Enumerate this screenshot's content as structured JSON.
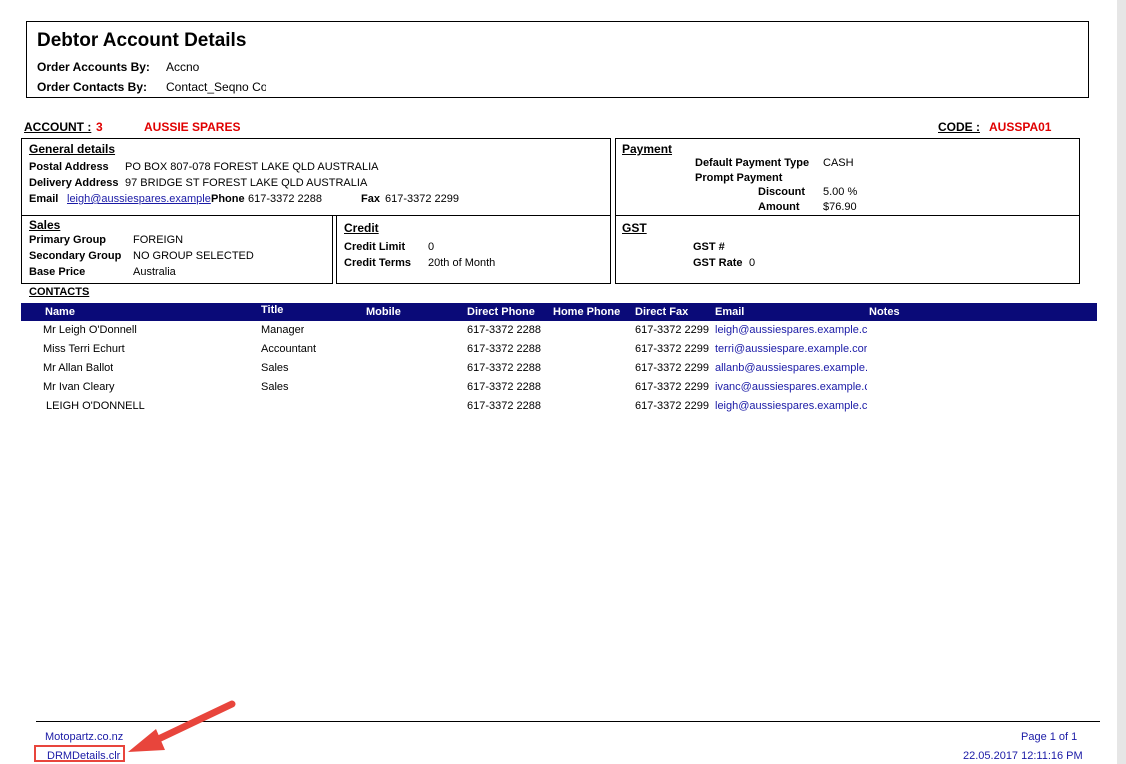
{
  "report": {
    "title": "Debtor Account Details",
    "order_accounts_label": "Order Accounts By:",
    "order_accounts_value": "Accno",
    "order_contacts_label": "Order Contacts By:",
    "order_contacts_value": "Contact_Seqno Co"
  },
  "account": {
    "account_label": "ACCOUNT :",
    "account_number": "3",
    "account_name": "AUSSIE SPARES",
    "code_label": "CODE :",
    "code_value": "AUSSPA01"
  },
  "general": {
    "heading": "General details",
    "postal_label": "Postal Address",
    "postal_value": "PO BOX 807-078 FOREST LAKE QLD AUSTRALIA",
    "delivery_label": "Delivery Address",
    "delivery_value": "97 BRIDGE ST FOREST LAKE QLD AUSTRALIA",
    "email_label": "Email",
    "email_value": "leigh@aussiespares.example",
    "phone_label": "Phone",
    "phone_value": "617-3372 2288",
    "fax_label": "Fax",
    "fax_value": "617-3372 2299"
  },
  "payment": {
    "heading": "Payment",
    "type_label": "Default Payment Type",
    "type_value": "CASH",
    "prompt_label": "Prompt Payment",
    "discount_label": "Discount",
    "discount_value": "5.00 %",
    "amount_label": "Amount",
    "amount_value": "$76.90"
  },
  "sales": {
    "heading": "Sales",
    "primary_label": "Primary Group",
    "primary_value": "FOREIGN",
    "secondary_label": "Secondary Group",
    "secondary_value": "NO GROUP SELECTED",
    "base_label": "Base Price",
    "base_value": "Australia"
  },
  "credit": {
    "heading": "Credit",
    "limit_label": "Credit Limit",
    "limit_value": "0",
    "terms_label": "Credit Terms",
    "terms_value": "20th of Month"
  },
  "gst": {
    "heading": "GST",
    "gst_no_label": "GST #",
    "rate_label": "GST Rate",
    "rate_value": "0"
  },
  "contacts": {
    "heading": "CONTACTS",
    "columns": [
      "Name",
      "Title",
      "Mobile",
      "Direct Phone",
      "Home Phone",
      "Direct Fax",
      "Email",
      "Notes"
    ],
    "rows": [
      {
        "name": "Mr Leigh O'Donnell",
        "title": "Manager",
        "mobile": "",
        "direct_phone": "617-3372 2288",
        "home_phone": "",
        "direct_fax": "617-3372 2299",
        "email": "leigh@aussiespares.example.c",
        "notes": ""
      },
      {
        "name": "Miss Terri Echurt",
        "title": "Accountant",
        "mobile": "",
        "direct_phone": "617-3372 2288",
        "home_phone": "",
        "direct_fax": "617-3372 2299",
        "email": "terri@aussiespare.example.cor",
        "notes": ""
      },
      {
        "name": "Mr Allan Ballot",
        "title": "Sales",
        "mobile": "",
        "direct_phone": "617-3372 2288",
        "home_phone": "",
        "direct_fax": "617-3372 2299",
        "email": "allanb@aussiespares.example.",
        "notes": ""
      },
      {
        "name": "Mr Ivan Cleary",
        "title": "Sales",
        "mobile": "",
        "direct_phone": "617-3372 2288",
        "home_phone": "",
        "direct_fax": "617-3372 2299",
        "email": "ivanc@aussiespares.example.c",
        "notes": ""
      },
      {
        "name": " LEIGH O'DONNELL",
        "title": "",
        "mobile": "",
        "direct_phone": "617-3372 2288",
        "home_phone": "",
        "direct_fax": "617-3372 2299",
        "email": "leigh@aussiespares.example.c",
        "notes": ""
      }
    ]
  },
  "footer": {
    "site": "Motopartz.co.nz",
    "file": "DRMDetails.clr",
    "page": "Page 1 of 1",
    "timestamp": "22.05.2017 12:11:16 PM"
  },
  "colors": {
    "header_bar": "#0a0a78",
    "account_red": "#e00000",
    "link_blue": "#1a1aa6",
    "annotation_arrow": "#e8453c"
  }
}
